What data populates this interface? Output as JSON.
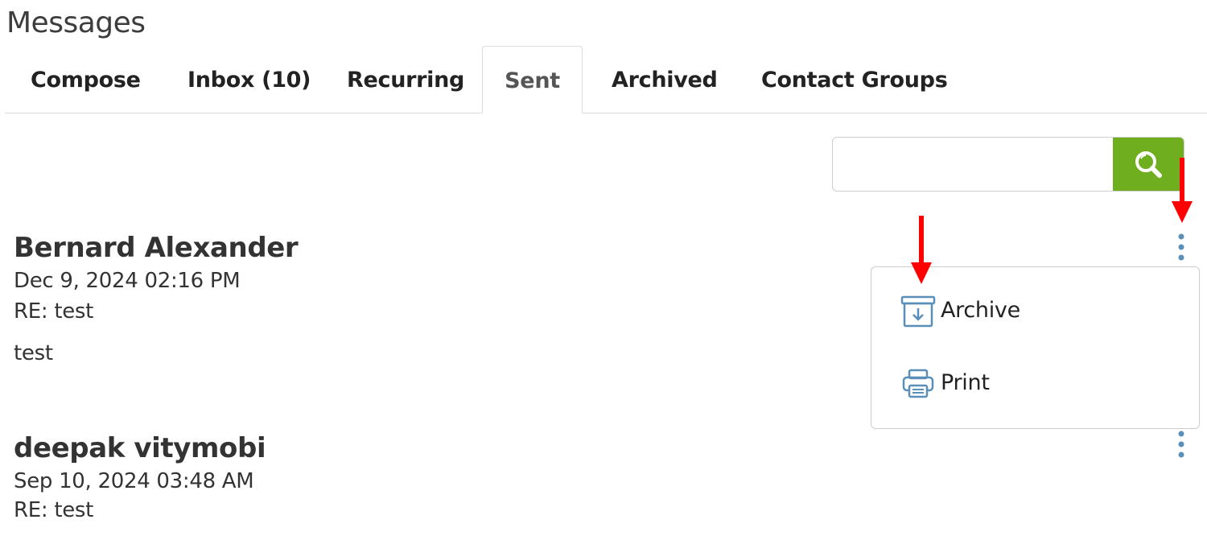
{
  "page": {
    "title": "Messages"
  },
  "tabs": [
    {
      "label": "Compose",
      "active": false
    },
    {
      "label": "Inbox (10)",
      "active": false
    },
    {
      "label": "Recurring",
      "active": false
    },
    {
      "label": "Sent",
      "active": true
    },
    {
      "label": "Archived",
      "active": false
    },
    {
      "label": "Contact Groups",
      "active": false
    }
  ],
  "search": {
    "value": "",
    "placeholder": "",
    "icon": "search-icon"
  },
  "messages": [
    {
      "name": "Bernard Alexander",
      "date": "Dec 9, 2024 02:16 PM",
      "subject": "RE: test",
      "body": "test"
    },
    {
      "name": "deepak vitymobi",
      "date": "Sep 10, 2024 03:48 AM",
      "subject": "RE: test"
    }
  ],
  "dropdown_menu": {
    "items": [
      {
        "label": "Archive",
        "icon": "archive-icon"
      },
      {
        "label": "Print",
        "icon": "print-icon"
      }
    ]
  },
  "colors": {
    "accent_green": "#6fae1f",
    "icon_blue": "#5a8fb8",
    "annotation_red": "#ff0000"
  }
}
